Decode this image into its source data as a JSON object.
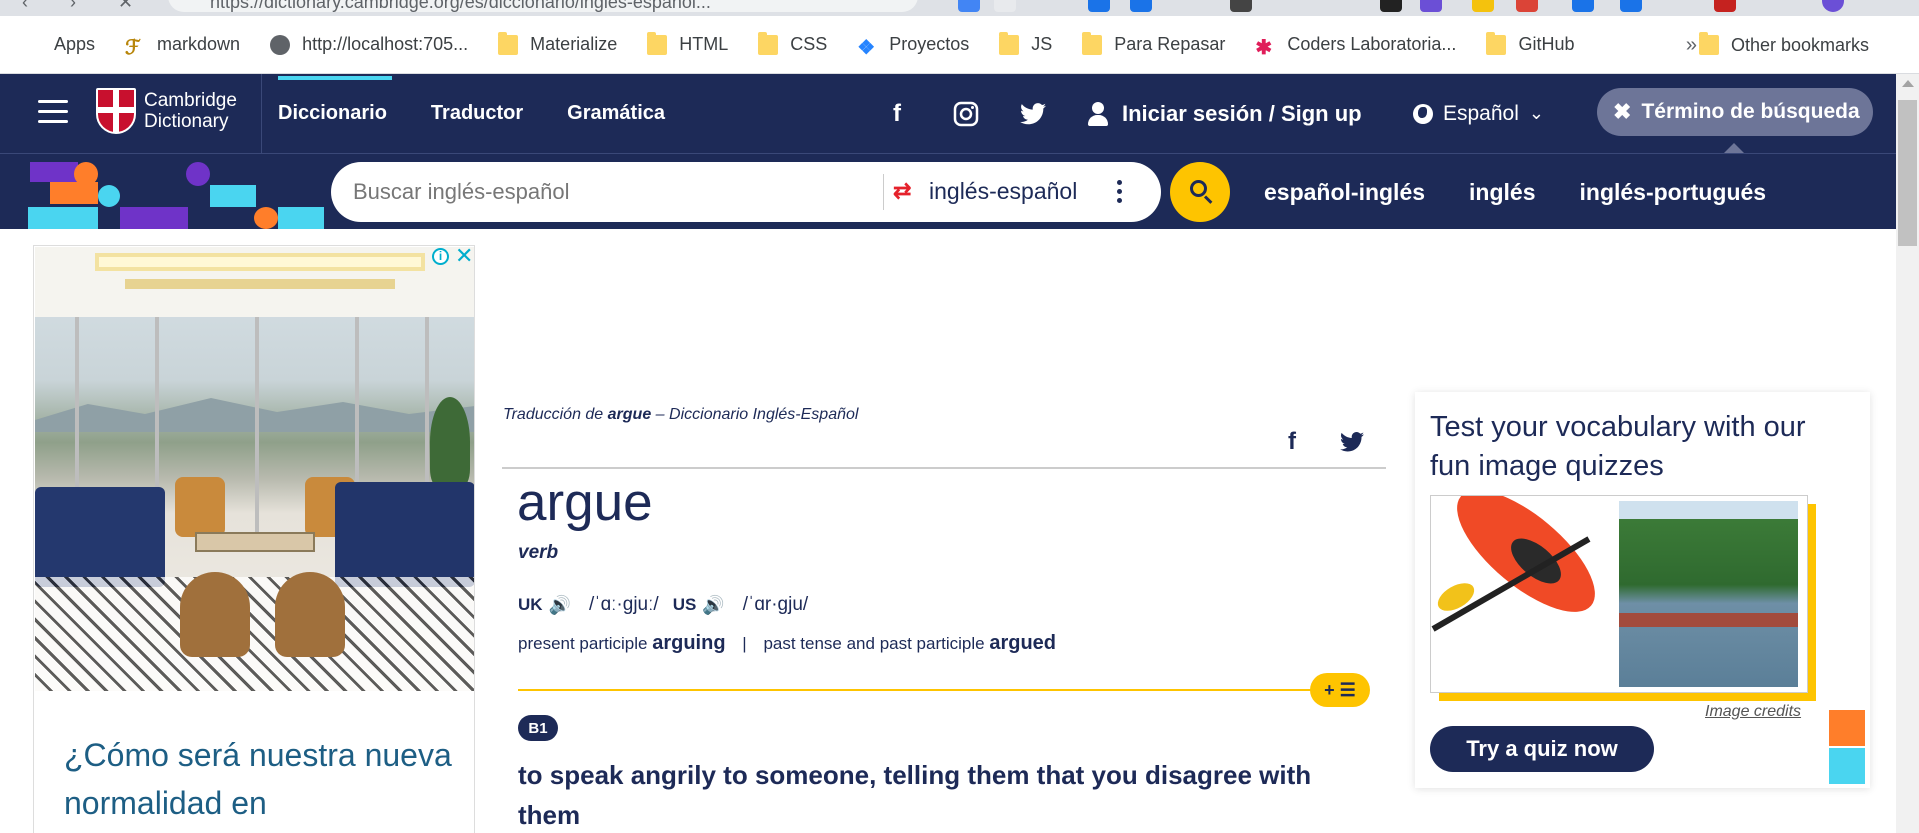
{
  "browser": {
    "url": "https://dictionary.cambridge.org/es/diccionario/ingles-espanol...",
    "bookmarks": [
      {
        "label": "Apps",
        "icon": "apps-grid-icon"
      },
      {
        "label": "markdown",
        "icon": "markdown-icon"
      },
      {
        "label": "http://localhost:705...",
        "icon": "globe-icon"
      },
      {
        "label": "Materialize",
        "icon": "folder-icon"
      },
      {
        "label": "HTML",
        "icon": "folder-icon"
      },
      {
        "label": "CSS",
        "icon": "folder-icon"
      },
      {
        "label": "Proyectos",
        "icon": "jira-icon"
      },
      {
        "label": "JS",
        "icon": "folder-icon"
      },
      {
        "label": "Para Repasar",
        "icon": "folder-icon"
      },
      {
        "label": "Coders Laboratoria...",
        "icon": "slack-icon"
      },
      {
        "label": "GitHub",
        "icon": "folder-icon"
      }
    ],
    "more": "»",
    "other_bookmarks": "Other bookmarks"
  },
  "header": {
    "logo_line1": "Cambridge",
    "logo_line2": "Dictionary",
    "nav": [
      "Diccionario",
      "Traductor",
      "Gramática"
    ],
    "signin": "Iniciar sesión / Sign up",
    "language": "Español",
    "search_term_btn": "Término de búsqueda",
    "colors": {
      "navy": "#1d2a57",
      "yellow": "#fec400",
      "cyan": "#4ad5f0"
    }
  },
  "search": {
    "placeholder": "Buscar inglés-español",
    "direction": "inglés-español",
    "links": [
      "español-inglés",
      "inglés",
      "inglés-portugués"
    ]
  },
  "ad": {
    "text": "¿Cómo será nuestra nueva normalidad en"
  },
  "entry": {
    "breadcrumb_prefix": "Traducción de ",
    "breadcrumb_word": "argue",
    "breadcrumb_suffix": " – Diccionario Inglés-Español",
    "headword": "argue",
    "pos": "verb",
    "uk_label": "UK",
    "uk_ipa": "/ˈɑː·gjuː/",
    "us_label": "US",
    "us_ipa": "/ˈɑr·gju/",
    "present_participle_label": "present participle",
    "present_participle": "arguing",
    "separator": "|",
    "past_label": "past tense and past participle",
    "past": "argued",
    "plus_list": "+ ☰",
    "level": "B1",
    "definition": "to speak angrily to someone, telling them that you disagree with them"
  },
  "quiz": {
    "title": "Test your vocabulary with our fun image quizzes",
    "image_credits": "Image credits",
    "button": "Try a quiz now"
  }
}
